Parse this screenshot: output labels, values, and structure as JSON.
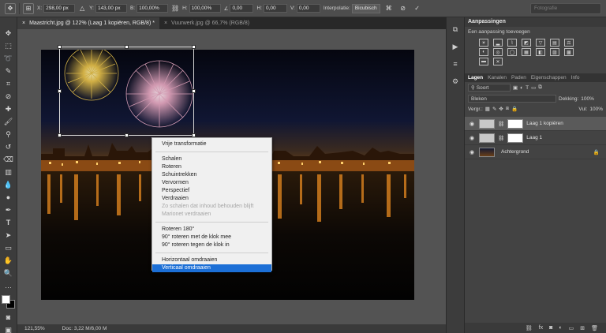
{
  "options_bar": {
    "x_label": "X:",
    "x_value": "298,00 px",
    "y_label": "Y:",
    "y_value": "143,00 px",
    "w_label": "B:",
    "w_value": "100,00%",
    "h_label": "H:",
    "h_value": "100,00%",
    "angle_value": "0,00",
    "hskew_label": "H:",
    "hskew_value": "0,00",
    "vskew_label": "V:",
    "vskew_value": "0,00",
    "interpolation_label": "Interpolatie:",
    "interpolation_value": "Bicubisch",
    "search_placeholder": "Fotografie"
  },
  "tabs": [
    {
      "label": "Maastricht.jpg @ 122% (Laag 1 kopiëren, RGB/8) *",
      "close": "×"
    },
    {
      "label": "Vuurwerk.jpg @ 66,7% (RGB/8)",
      "close": "×"
    }
  ],
  "context_menu": {
    "items": [
      {
        "label": "Vrije transformatie",
        "state": "normal"
      },
      {
        "separator": true
      },
      {
        "label": "Schalen",
        "state": "normal"
      },
      {
        "label": "Roteren",
        "state": "normal"
      },
      {
        "label": "Schuintrekken",
        "state": "normal"
      },
      {
        "label": "Vervormen",
        "state": "normal"
      },
      {
        "label": "Perspectief",
        "state": "normal"
      },
      {
        "label": "Verdraaien",
        "state": "normal"
      },
      {
        "label": "Zo schalen dat inhoud behouden blijft",
        "state": "disabled"
      },
      {
        "label": "Marionet verdraaien",
        "state": "disabled"
      },
      {
        "separator": true
      },
      {
        "label": "Roteren 180°",
        "state": "normal"
      },
      {
        "label": "90° roteren met de klok mee",
        "state": "normal"
      },
      {
        "label": "90° roteren tegen de klok in",
        "state": "normal"
      },
      {
        "separator": true
      },
      {
        "label": "Horizontaal omdraaien",
        "state": "normal"
      },
      {
        "label": "Verticaal omdraaien",
        "state": "selected"
      }
    ]
  },
  "status": {
    "zoom": "121,55%",
    "doc": "Doc: 3,22 M/6,00 M"
  },
  "adjustments": {
    "title": "Aanpassingen",
    "subtitle": "Een aanpassing toevoegen"
  },
  "layers_panel": {
    "tabs": [
      "Lagen",
      "Kanalen",
      "Paden",
      "Eigenschappen",
      "Info"
    ],
    "filter_label": "Soort",
    "blend_mode": "Bleken",
    "opacity_label": "Dekking:",
    "opacity_value": "100%",
    "lock_label": "Vergr.:",
    "fill_label": "Vul:",
    "fill_value": "100%",
    "layers": [
      {
        "name": "Laag 1 kopiëren",
        "selected": true
      },
      {
        "name": "Laag 1",
        "selected": false
      },
      {
        "name": "Achtergrond",
        "selected": false
      }
    ]
  }
}
